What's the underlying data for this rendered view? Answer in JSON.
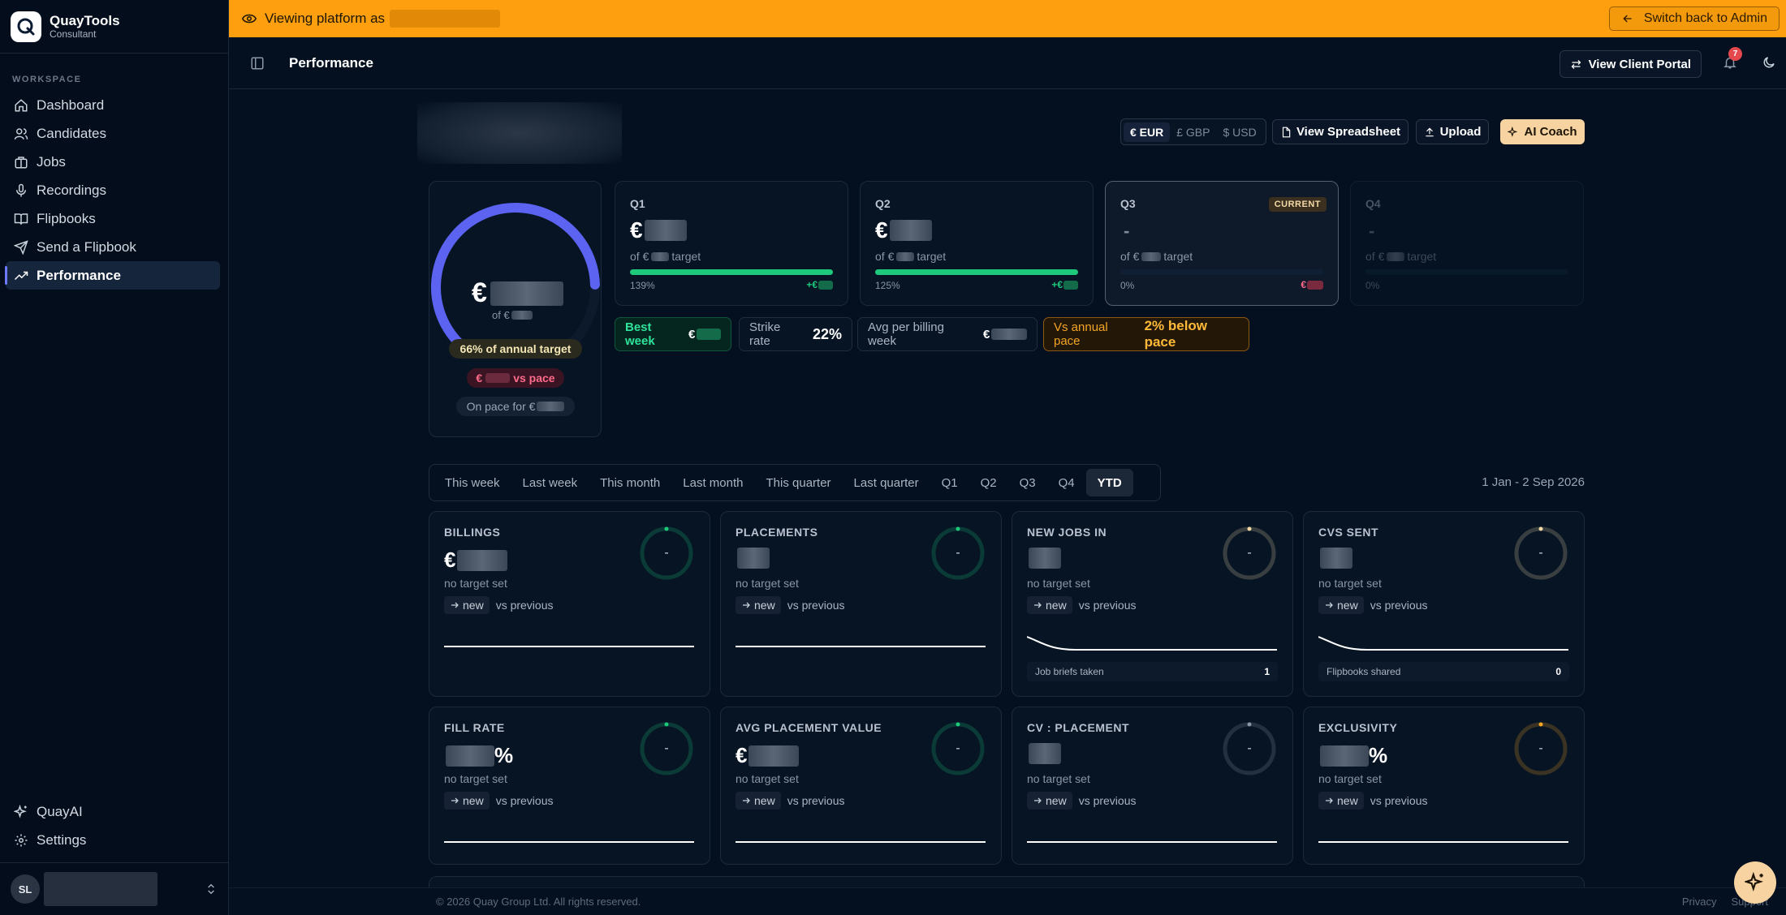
{
  "app": {
    "name": "QuayTools",
    "role": "Consultant"
  },
  "sidebar": {
    "section": "WORKSPACE",
    "items": [
      {
        "label": "Dashboard",
        "icon": "home-icon"
      },
      {
        "label": "Candidates",
        "icon": "users-icon"
      },
      {
        "label": "Jobs",
        "icon": "briefcase-icon"
      },
      {
        "label": "Recordings",
        "icon": "mic-icon"
      },
      {
        "label": "Flipbooks",
        "icon": "book-icon"
      },
      {
        "label": "Send a Flipbook",
        "icon": "send-icon"
      },
      {
        "label": "Performance",
        "icon": "trending-icon",
        "active": true
      }
    ],
    "bottom": [
      {
        "label": "QuayAI",
        "icon": "sparkle-icon"
      },
      {
        "label": "Settings",
        "icon": "gear-icon"
      }
    ],
    "user_initials": "SL"
  },
  "banner": {
    "text": "Viewing platform as",
    "switch_label": "Switch back to Admin",
    "color": "#fd9f0e"
  },
  "topbar": {
    "title": "Performance",
    "portal_label": "View Client Portal",
    "notifications": "7"
  },
  "toolbar": {
    "currencies": [
      "€ EUR",
      "£ GBP",
      "$ USD"
    ],
    "selected_currency": "€ EUR",
    "spreadsheet_label": "View Spreadsheet",
    "upload_label": "Upload",
    "coach_label": "AI Coach"
  },
  "annual": {
    "currency": "€",
    "of_prefix": "of €",
    "percent_label": "66% of annual target",
    "progress": 0.66,
    "pace_currency": "€",
    "pace_label": "vs pace",
    "on_pace_label": "On pace for €"
  },
  "quarters": [
    {
      "name": "Q1",
      "value_prefix": "€",
      "target_prefix": "of €",
      "target_suffix": "target",
      "pct": "139%",
      "delta": "+€",
      "fill": 1.0,
      "current": false
    },
    {
      "name": "Q2",
      "value_prefix": "€",
      "target_prefix": "of €",
      "target_suffix": "target",
      "pct": "125%",
      "delta": "+€",
      "fill": 1.0,
      "current": false
    },
    {
      "name": "Q3",
      "value_prefix": "-",
      "target_prefix": "of €",
      "target_suffix": "target",
      "pct": "0%",
      "delta": "€",
      "fill": 0,
      "current": true,
      "badge": "CURRENT"
    },
    {
      "name": "Q4",
      "value_prefix": "-",
      "target_prefix": "of €",
      "target_suffix": "target",
      "pct": "0%",
      "delta": "",
      "fill": 0,
      "current": false
    }
  ],
  "stats": {
    "best_week_label": "Best week",
    "best_week_currency": "€",
    "strike_label": "Strike rate",
    "strike_value": "22%",
    "avg_label": "Avg per billing week",
    "avg_currency": "€",
    "pace_label": "Vs annual pace",
    "pace_value": "2% below pace"
  },
  "periods": [
    "This week",
    "Last week",
    "This month",
    "Last month",
    "This quarter",
    "Last quarter",
    "Q1",
    "Q2",
    "Q3",
    "Q4",
    "YTD"
  ],
  "selected_period": "YTD",
  "date_range": "1 Jan - 2 Sep 2026",
  "metrics": [
    {
      "title": "BILLINGS",
      "prefix": "€",
      "suffix": "",
      "target": "no target set",
      "trend": "new",
      "vs": "vs previous",
      "ring": "-",
      "ring_color": "#1ec97c",
      "sub_label": "",
      "sub_value": ""
    },
    {
      "title": "PLACEMENTS",
      "prefix": "",
      "suffix": "",
      "target": "no target set",
      "trend": "new",
      "vs": "vs previous",
      "ring": "-",
      "ring_color": "#1ec97c",
      "sub_label": "",
      "sub_value": ""
    },
    {
      "title": "NEW JOBS IN",
      "prefix": "",
      "suffix": "",
      "target": "no target set",
      "trend": "new",
      "vs": "vs previous",
      "ring": "-",
      "ring_color": "#f3d9a6",
      "sub_label": "Job briefs taken",
      "sub_value": "1"
    },
    {
      "title": "CVS SENT",
      "prefix": "",
      "suffix": "",
      "target": "no target set",
      "trend": "new",
      "vs": "vs previous",
      "ring": "-",
      "ring_color": "#f3d9a6",
      "sub_label": "Flipbooks shared",
      "sub_value": "0"
    },
    {
      "title": "FILL RATE",
      "prefix": "",
      "suffix": "%",
      "target": "no target set",
      "trend": "new",
      "vs": "vs previous",
      "ring": "-",
      "ring_color": "#1ec97c",
      "sub_label": "",
      "sub_value": ""
    },
    {
      "title": "AVG PLACEMENT VALUE",
      "prefix": "€",
      "suffix": "",
      "target": "no target set",
      "trend": "new",
      "vs": "vs previous",
      "ring": "-",
      "ring_color": "#1ec97c",
      "sub_label": "",
      "sub_value": ""
    },
    {
      "title": "CV : PLACEMENT",
      "prefix": "",
      "suffix": "",
      "target": "no target set",
      "trend": "new",
      "vs": "vs previous",
      "ring": "-",
      "ring_color": "#8b96a6",
      "sub_label": "",
      "sub_value": ""
    },
    {
      "title": "EXCLUSIVITY",
      "prefix": "",
      "suffix": "%",
      "target": "no target set",
      "trend": "new",
      "vs": "vs previous",
      "ring": "-",
      "ring_color": "#f5a524",
      "sub_label": "",
      "sub_value": ""
    }
  ],
  "footer": {
    "copyright": "© 2026 Quay Group Ltd. All rights reserved.",
    "privacy": "Privacy",
    "support": "Support"
  }
}
